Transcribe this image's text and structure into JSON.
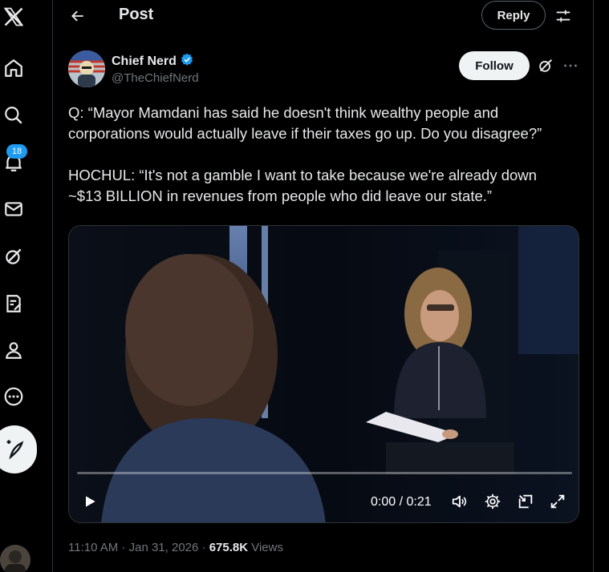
{
  "header": {
    "title": "Post",
    "reply_label": "Reply"
  },
  "nav": {
    "notifications_badge": "18",
    "icons": [
      "x-logo-icon",
      "home-icon",
      "search-icon",
      "notifications-icon",
      "messages-icon",
      "grok-icon",
      "lists-icon",
      "profile-icon",
      "more-icon",
      "compose-icon"
    ]
  },
  "author": {
    "name": "Chief Nerd",
    "handle": "@TheChiefNerd",
    "verified": true,
    "follow_label": "Follow"
  },
  "tweet": {
    "paragraph1": "Q: “Mayor Mamdani has said he doesn't think wealthy people and\ncorporations would actually leave if their taxes go up. Do you disagree?”",
    "paragraph2": "HOCHUL: “It's not a gamble I want to take because we're already down\n~$13 BILLION in revenues from people who did leave our state.”"
  },
  "video": {
    "current_time": "0:00",
    "separator": " / ",
    "duration": "0:21",
    "progress": 0
  },
  "meta": {
    "time": "11:10 AM",
    "dot1": " · ",
    "date": "Jan 31, 2026",
    "dot2": " · ",
    "views_count": "675.8K",
    "views_label": " Views"
  },
  "colors": {
    "accent": "#1d9bf0",
    "background": "#000000",
    "text_primary": "#e7e9ea",
    "text_secondary": "#71767b"
  }
}
